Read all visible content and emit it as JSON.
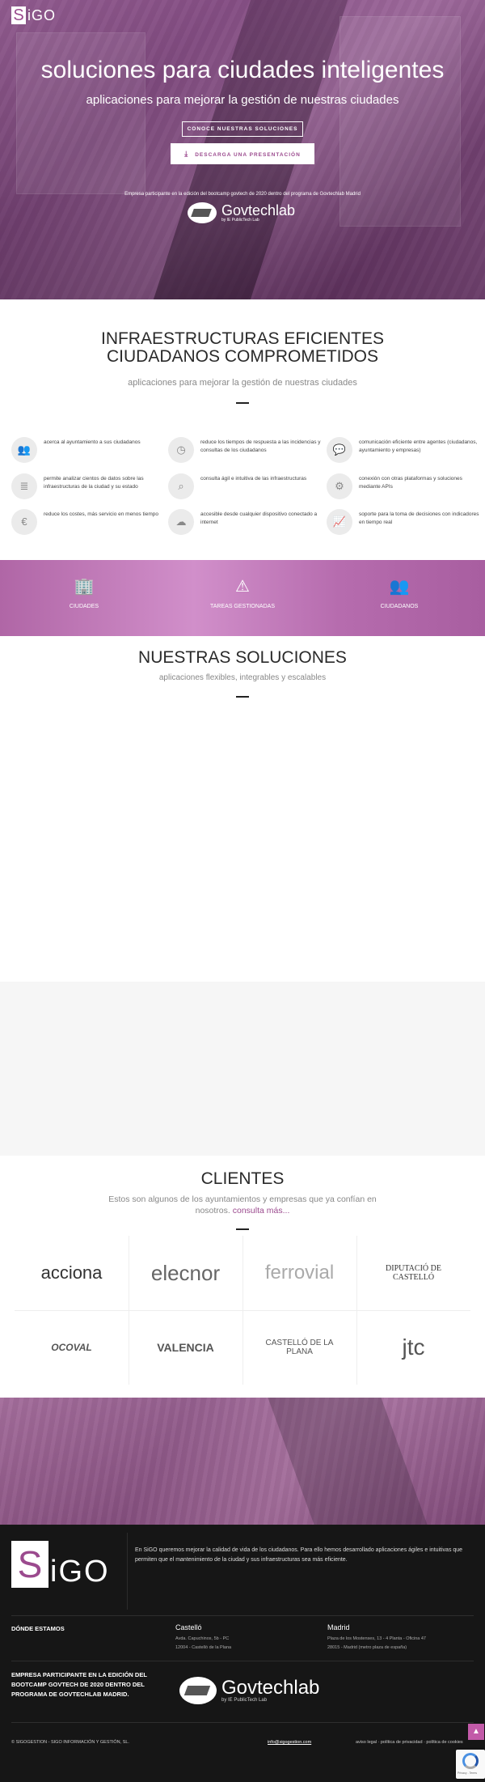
{
  "brand": {
    "logo_s": "S",
    "logo_rest": "iGO"
  },
  "hero": {
    "title": "soluciones para ciudades inteligentes",
    "subtitle": "aplicaciones para mejorar la gestión de nuestras ciudades",
    "btn_solutions": "CONOCE NUESTRAS SOLUCIONES",
    "btn_download": "DESCARGA UNA PRESENTACIÓN",
    "participant": "Empresa participante en la edición del bootcamp govtech de 2020 dentro del programa de Govtechlab Madrid",
    "gov_name": "Govtechlab",
    "gov_sub": "by IE PublicTech Lab"
  },
  "infra": {
    "title_line1": "INFRAESTRUCTURAS EFICIENTES",
    "title_line2": "CIUDADANOS COMPROMETIDOS",
    "subtitle": "aplicaciones para mejorar la gestión de nuestras ciudades",
    "features": [
      {
        "icon": "users-icon",
        "glyph": "👥",
        "text": "acerca al ayuntamiento a sus ciudadanos"
      },
      {
        "icon": "clock-icon",
        "glyph": "◷",
        "text": "reduce los tiempos de respuesta a las incidencias y consultas de los ciudadanos"
      },
      {
        "icon": "chat-icon",
        "glyph": "💬",
        "text": "comunicación eficiente entre agentes (ciudadanos, ayuntamiento y empresas)"
      },
      {
        "icon": "database-icon",
        "glyph": "≣",
        "text": "permite analizar cientos de datos sobre las infraestructuras de la ciudad y su estado"
      },
      {
        "icon": "search-icon",
        "glyph": "⌕",
        "text": "consulta ágil e intuitiva de las infraestructuras"
      },
      {
        "icon": "cogs-icon",
        "glyph": "⚙",
        "text": "conexión con otras plataformas y soluciones mediante APIs"
      },
      {
        "icon": "euro-icon",
        "glyph": "€",
        "text": "reduce los costes, más servicio en menos tiempo"
      },
      {
        "icon": "cloud-icon",
        "glyph": "☁",
        "text": "accesible desde cualquier dispositivo conectado a internet"
      },
      {
        "icon": "chart-line-icon",
        "glyph": "📈",
        "text": "soporte para la toma de decisiones con indicadores en tiempo real"
      }
    ]
  },
  "stats": [
    {
      "icon": "building-icon",
      "glyph": "🏢",
      "label": "CIUDADES"
    },
    {
      "icon": "warning-icon",
      "glyph": "⚠",
      "label": "TAREAS GESTIONADAS"
    },
    {
      "icon": "users-icon",
      "glyph": "👥",
      "label": "CIUDADANOS"
    }
  ],
  "solutions": {
    "title": "NUESTRAS SOLUCIONES",
    "subtitle": "aplicaciones flexibles, integrables y escalables"
  },
  "clients": {
    "title": "CLIENTES",
    "subtitle": "Estos son algunos de los ayuntamientos y empresas que ya confían en nosotros.",
    "link": "consulta más...",
    "logos": [
      "acciona",
      "elecnor",
      "ferrovial",
      "DIPUTACIÓ DE CASTELLÓ",
      "OCOVAL",
      "VALENCIA",
      "CASTELLÓ DE LA PLANA",
      "jtc"
    ]
  },
  "footer": {
    "about": "En SiGO queremos mejorar la calidad de vida de los ciudadanos. Para ello hemos desarrollado aplicaciones ágiles e intuitivas que permiten que el mantenimiento de la ciudad y sus infraestructuras sea más eficiente.",
    "where_title": "DÓNDE ESTAMOS",
    "castello_title": "Castelló",
    "castello_addr1": "Avda. Capuchinos, 5b - PC",
    "castello_addr2": "12004 - Castelló de la Plana",
    "madrid_title": "Madrid",
    "madrid_addr1": "Plaza de los Mostenses, 13 - 4 Planta - Oficina 47",
    "madrid_addr2": "28015 - Madrid (metro plaza de españa)",
    "participant": "EMPRESA PARTICIPANTE EN LA EDICIÓN DEL BOOTCAMP GOVTECH DE 2020 DENTRO DEL PROGRAMA DE GOVTECHLAB MADRID.",
    "gov_name": "Govtechlab",
    "gov_sub": "by IE PublicTech Lab",
    "copyright": "© SIGOGESTION - SIGO INFORMACIÓN Y GESTIÓN, SL.",
    "email": "info@sigogestion.com",
    "legal": "aviso legal · política de privacidad · política de cookies",
    "recaptcha": "Privacy - Terms"
  }
}
